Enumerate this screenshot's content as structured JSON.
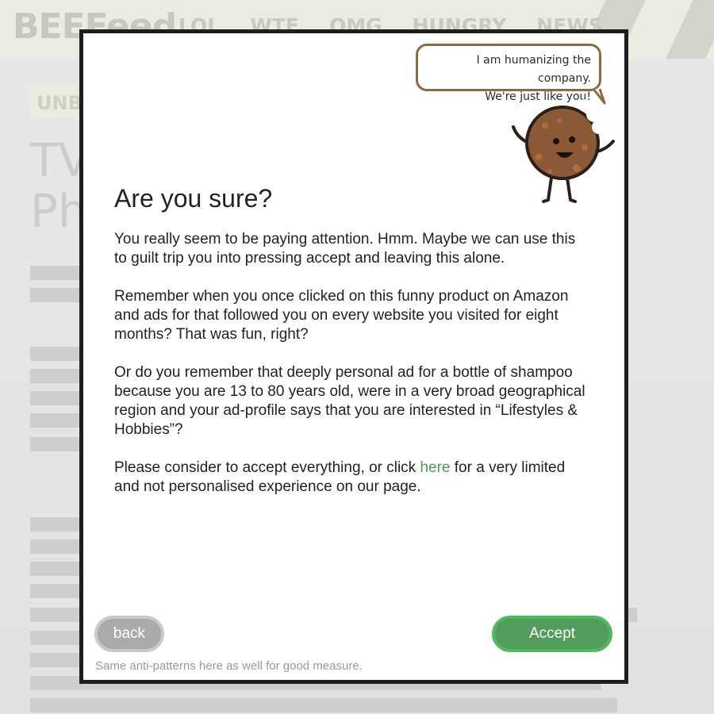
{
  "background": {
    "logo": "BEEFeed",
    "nav": [
      "LOL",
      "WTF",
      "OMG",
      "HUNGRY",
      "NEWS"
    ],
    "tag": "UNB",
    "headline_1": "TV",
    "headline_2": "Pho"
  },
  "modal": {
    "speech_bubble": {
      "line1": "I am humanizing the company.",
      "line2": "We're just like you!"
    },
    "mascot_icon": "cookie-mascot-icon",
    "title": "Are you sure?",
    "paragraphs": [
      "You really seem to be paying attention. Hmm. Maybe we can use this to guilt trip you into pressing accept and leaving this alone.",
      "Remember when you once clicked on this funny product on Amazon and ads for that followed you on every website you visited for eight months? That was fun, right?",
      "Or do you remember that deeply personal ad for a bottle of shampoo because you are 13 to 80 years old, were in a very broad geographical region and your ad-profile says that you are interested in “Lifestyles & Hobbies”?"
    ],
    "last_paragraph": {
      "before": "Please consider to accept everything, or click ",
      "link": "here",
      "after": " for a very limited and not personalised experience on our page."
    },
    "back_label": "back",
    "accept_label": "Accept",
    "footnote": "Same anti-patterns here as well for good measure."
  },
  "colors": {
    "accept": "#529d5c",
    "accept_border": "#50bb5e",
    "back": "#a9aaac",
    "link": "#4a9a55",
    "bubble_border": "#8d6a46",
    "cookie": "#8a5a36"
  }
}
